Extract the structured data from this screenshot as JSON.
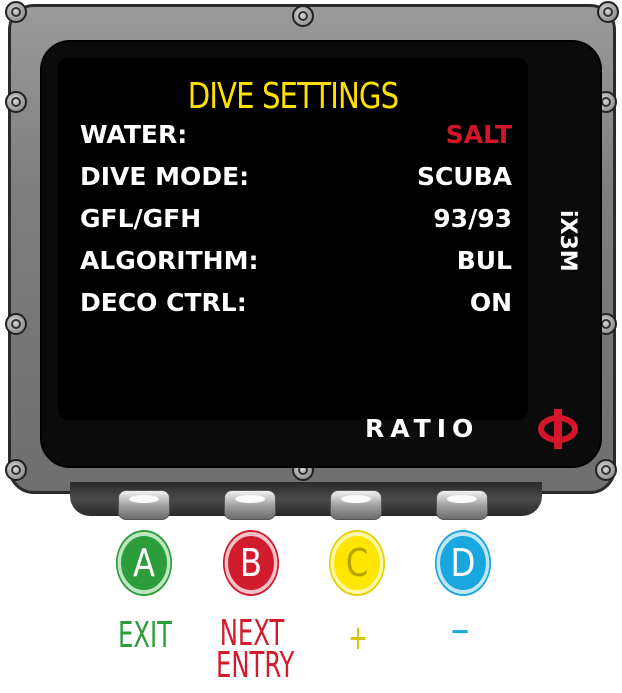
{
  "screen": {
    "title": "DIVE SETTINGS",
    "settings": [
      {
        "label": "WATER:",
        "value": "SALT"
      },
      {
        "label": "DIVE MODE:",
        "value": "SCUBA"
      },
      {
        "label": "GFL/GFH",
        "value": "93/93"
      },
      {
        "label": "ALGORITHM:",
        "value": "BUL"
      },
      {
        "label": "DECO CTRL:",
        "value": "ON"
      }
    ]
  },
  "device": {
    "model": "iX3M",
    "brand": "RATIO",
    "logo_icon": "phi-logo-icon"
  },
  "buttons": [
    {
      "letter": "A",
      "caption": "EXIT",
      "color": "#2c9d3a"
    },
    {
      "letter": "B",
      "caption_line1": "NEXT",
      "caption_line2": "ENTRY",
      "color": "#d01c2d"
    },
    {
      "letter": "C",
      "caption": "+",
      "color": "#ffe600"
    },
    {
      "letter": "D",
      "caption": "−",
      "color": "#1aa6de"
    }
  ],
  "colors": {
    "title": "#ffe100",
    "highlight_value": "#d3162a"
  }
}
